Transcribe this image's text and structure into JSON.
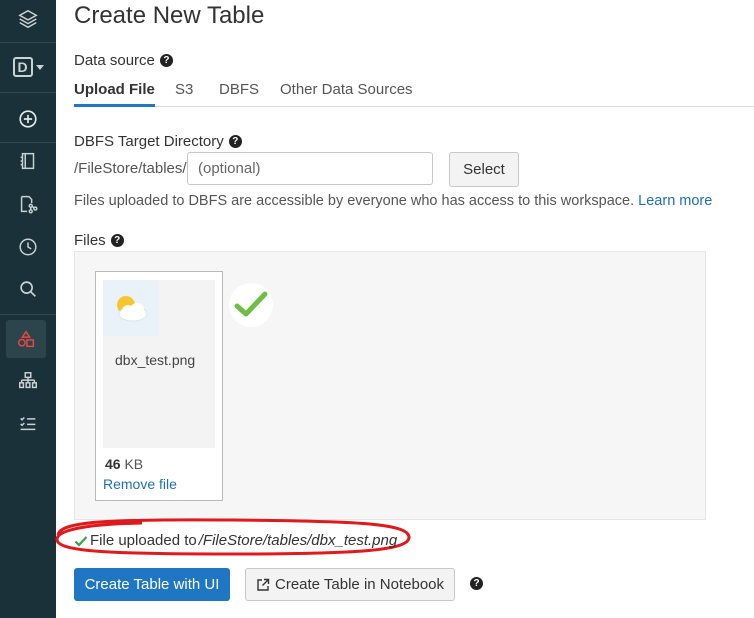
{
  "page": {
    "title": "Create New Table"
  },
  "data_source": {
    "label": "Data source",
    "tabs": [
      {
        "label": "Upload File",
        "active": true
      },
      {
        "label": "S3",
        "active": false
      },
      {
        "label": "DBFS",
        "active": false
      },
      {
        "label": "Other Data Sources",
        "active": false
      }
    ]
  },
  "target_dir": {
    "label": "DBFS Target Directory",
    "prefix": "/FileStore/tables/",
    "placeholder": "(optional)",
    "select_label": "Select",
    "note": "Files uploaded to DBFS are accessible by everyone who has access to this workspace.",
    "learn_more": "Learn more"
  },
  "files": {
    "label": "Files",
    "items": [
      {
        "name": "dbx_test.png",
        "size_value": "46",
        "size_unit": "KB",
        "remove_label": "Remove file"
      }
    ]
  },
  "status": {
    "prefix": "File uploaded to",
    "path": "/FileStore/tables/dbx_test.png"
  },
  "actions": {
    "create_ui": "Create Table with UI",
    "create_notebook": "Create Table in Notebook"
  },
  "sidebar": {
    "workspace_initial": "D",
    "icons": [
      "layers-icon",
      "workspace-switcher-icon",
      "create-icon",
      "notebook-icon",
      "repos-icon",
      "recents-icon",
      "search-icon",
      "data-icon",
      "clusters-icon",
      "jobs-icon"
    ]
  },
  "colors": {
    "sidebar_bg": "#1b3139",
    "accent": "#1f77c4",
    "success": "#4caf50",
    "annotation": "#e0191c",
    "active_sidebar_icon": "#e8483f"
  }
}
